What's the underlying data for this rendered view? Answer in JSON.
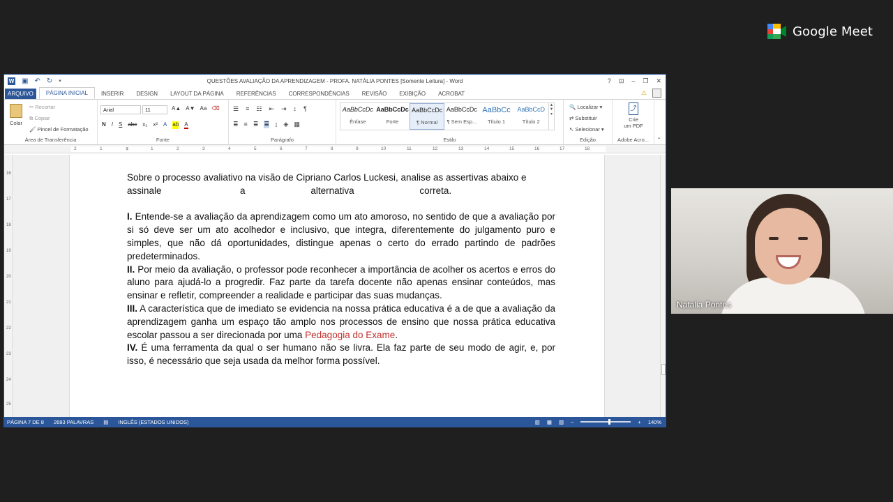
{
  "meet": {
    "brand": "Google Meet",
    "participant_name": "Natalia Pontes"
  },
  "window": {
    "title": "QUESTÕES AVALIAÇÃO DA APRENDIZAGEM - PROFA. NATÁLIA PONTES [Somente Leitura] - Word",
    "controls": [
      "?",
      "⊡",
      "–",
      "❐",
      "✕"
    ]
  },
  "tabs": [
    "ARQUIVO",
    "PÁGINA INICIAL",
    "INSERIR",
    "DESIGN",
    "LAYOUT DA PÁGINA",
    "REFERÊNCIAS",
    "CORRESPONDÊNCIAS",
    "REVISÃO",
    "EXIBIÇÃO",
    "ACROBAT"
  ],
  "ribbon": {
    "clipboard": {
      "paste": "Colar",
      "cut": "Recortar",
      "copy": "Copiar",
      "format_painter": "Pincel de Formatação",
      "label": "Área de Transferência"
    },
    "font": {
      "name": "Arial",
      "size": "11",
      "label": "Fonte",
      "bold": "N",
      "italic": "I",
      "underline": "S",
      "strike": "abc",
      "sub": "x₂",
      "sup": "x²"
    },
    "paragraph": {
      "label": "Parágrafo"
    },
    "styles": {
      "label": "Estilo",
      "items": [
        {
          "preview": "AaBbCcDc",
          "name": "Ênfase"
        },
        {
          "preview": "AaBbCcDc",
          "name": "Forte"
        },
        {
          "preview": "AaBbCcDc",
          "name": "¶ Normal"
        },
        {
          "preview": "AaBbCcDc",
          "name": "¶ Sem Esp..."
        },
        {
          "preview": "AaBbCc",
          "name": "Título 1"
        },
        {
          "preview": "AaBbCcD",
          "name": "Título 2"
        }
      ]
    },
    "editing": {
      "find": "Localizar",
      "replace": "Substituir",
      "select": "Selecionar",
      "label": "Edição"
    },
    "pdf": {
      "line1": "Crie",
      "line2": "um PDF",
      "label": "Adobe Acro..."
    }
  },
  "ruler": {
    "h_numbers": [
      "2",
      "1",
      "1",
      "2",
      "3",
      "4",
      "5",
      "6",
      "7",
      "8",
      "9",
      "10",
      "11",
      "12",
      "13",
      "14",
      "15",
      "16",
      "17",
      "18"
    ],
    "v_numbers": [
      "16",
      "17",
      "18",
      "19",
      "20",
      "21",
      "22",
      "23",
      "24",
      "25"
    ]
  },
  "document": {
    "intro_a": "Sobre o processo avaliativo na visão de Cipriano Carlos Luckesi, analise as assertivas abaixo e",
    "intro_b": "assinale                              a                         alternativa                         correta.",
    "i_label": "I.",
    "i_text": " Entende-se a avaliação da aprendizagem como um ato amoroso, no sentido de que a avaliação por si só deve ser um ato acolhedor e inclusivo, que integra, diferentemente do julgamento puro e simples, que não dá oportunidades, distingue apenas o certo do errado partindo de padrões predeterminados.",
    "ii_label": "II.",
    "ii_text": " Por meio da avaliação, o professor pode reconhecer a importância de acolher os acertos e erros do aluno para ajudá-lo a progredir. Faz parte da tarefa docente não apenas ensinar conteúdos, mas ensinar e refletir, compreender a realidade e participar das suas mudanças.",
    "iii_label": "III.",
    "iii_text": " A característica que de imediato se evidencia na nossa prática educativa é a de que a avaliação da aprendizagem ganha um espaço tão amplo nos processos de ensino que nossa prática educativa escolar passou a ser direcionada por uma ",
    "iii_red": "Pedagogia do Exame",
    "iii_end": ".",
    "iv_label": "IV.",
    "iv_text": " É uma ferramenta da qual o ser humano não se livra. Ela faz parte de seu modo de agir, e, por isso, é necessário que seja usada da melhor forma possível."
  },
  "status": {
    "page": "PÁGINA 7 DE 8",
    "words": "2683 PALAVRAS",
    "language": "INGLÊS (ESTADOS UNIDOS)",
    "zoom": "140%"
  }
}
